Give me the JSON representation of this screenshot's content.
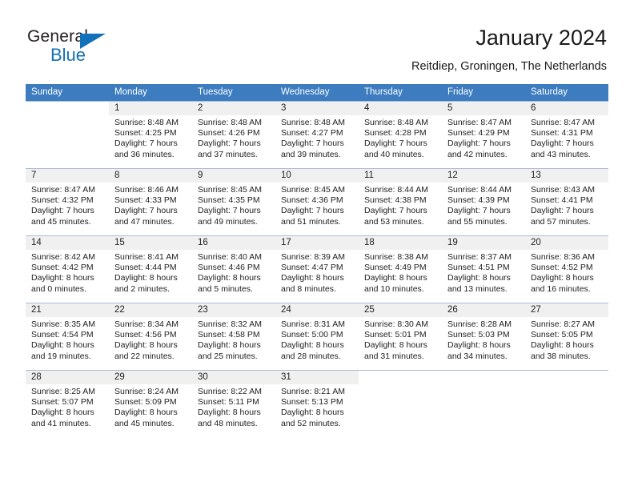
{
  "brand": {
    "name_part1": "General",
    "name_part2": "Blue",
    "logo_icon": "triangle-icon"
  },
  "header": {
    "title": "January 2024",
    "subtitle": "Reitdiep, Groningen, The Netherlands"
  },
  "colors": {
    "header_row_bg": "#3c7cbf",
    "daynum_band_bg": "#f0f0f0",
    "grid_line": "#a9bdd4",
    "brand_blue": "#1271b8",
    "text": "#222222"
  },
  "weekday_headers": [
    "Sunday",
    "Monday",
    "Tuesday",
    "Wednesday",
    "Thursday",
    "Friday",
    "Saturday"
  ],
  "weeks": [
    [
      {
        "day": "",
        "lines": []
      },
      {
        "day": "1",
        "lines": [
          "Sunrise: 8:48 AM",
          "Sunset: 4:25 PM",
          "Daylight: 7 hours",
          "and 36 minutes."
        ]
      },
      {
        "day": "2",
        "lines": [
          "Sunrise: 8:48 AM",
          "Sunset: 4:26 PM",
          "Daylight: 7 hours",
          "and 37 minutes."
        ]
      },
      {
        "day": "3",
        "lines": [
          "Sunrise: 8:48 AM",
          "Sunset: 4:27 PM",
          "Daylight: 7 hours",
          "and 39 minutes."
        ]
      },
      {
        "day": "4",
        "lines": [
          "Sunrise: 8:48 AM",
          "Sunset: 4:28 PM",
          "Daylight: 7 hours",
          "and 40 minutes."
        ]
      },
      {
        "day": "5",
        "lines": [
          "Sunrise: 8:47 AM",
          "Sunset: 4:29 PM",
          "Daylight: 7 hours",
          "and 42 minutes."
        ]
      },
      {
        "day": "6",
        "lines": [
          "Sunrise: 8:47 AM",
          "Sunset: 4:31 PM",
          "Daylight: 7 hours",
          "and 43 minutes."
        ]
      }
    ],
    [
      {
        "day": "7",
        "lines": [
          "Sunrise: 8:47 AM",
          "Sunset: 4:32 PM",
          "Daylight: 7 hours",
          "and 45 minutes."
        ]
      },
      {
        "day": "8",
        "lines": [
          "Sunrise: 8:46 AM",
          "Sunset: 4:33 PM",
          "Daylight: 7 hours",
          "and 47 minutes."
        ]
      },
      {
        "day": "9",
        "lines": [
          "Sunrise: 8:45 AM",
          "Sunset: 4:35 PM",
          "Daylight: 7 hours",
          "and 49 minutes."
        ]
      },
      {
        "day": "10",
        "lines": [
          "Sunrise: 8:45 AM",
          "Sunset: 4:36 PM",
          "Daylight: 7 hours",
          "and 51 minutes."
        ]
      },
      {
        "day": "11",
        "lines": [
          "Sunrise: 8:44 AM",
          "Sunset: 4:38 PM",
          "Daylight: 7 hours",
          "and 53 minutes."
        ]
      },
      {
        "day": "12",
        "lines": [
          "Sunrise: 8:44 AM",
          "Sunset: 4:39 PM",
          "Daylight: 7 hours",
          "and 55 minutes."
        ]
      },
      {
        "day": "13",
        "lines": [
          "Sunrise: 8:43 AM",
          "Sunset: 4:41 PM",
          "Daylight: 7 hours",
          "and 57 minutes."
        ]
      }
    ],
    [
      {
        "day": "14",
        "lines": [
          "Sunrise: 8:42 AM",
          "Sunset: 4:42 PM",
          "Daylight: 8 hours",
          "and 0 minutes."
        ]
      },
      {
        "day": "15",
        "lines": [
          "Sunrise: 8:41 AM",
          "Sunset: 4:44 PM",
          "Daylight: 8 hours",
          "and 2 minutes."
        ]
      },
      {
        "day": "16",
        "lines": [
          "Sunrise: 8:40 AM",
          "Sunset: 4:46 PM",
          "Daylight: 8 hours",
          "and 5 minutes."
        ]
      },
      {
        "day": "17",
        "lines": [
          "Sunrise: 8:39 AM",
          "Sunset: 4:47 PM",
          "Daylight: 8 hours",
          "and 8 minutes."
        ]
      },
      {
        "day": "18",
        "lines": [
          "Sunrise: 8:38 AM",
          "Sunset: 4:49 PM",
          "Daylight: 8 hours",
          "and 10 minutes."
        ]
      },
      {
        "day": "19",
        "lines": [
          "Sunrise: 8:37 AM",
          "Sunset: 4:51 PM",
          "Daylight: 8 hours",
          "and 13 minutes."
        ]
      },
      {
        "day": "20",
        "lines": [
          "Sunrise: 8:36 AM",
          "Sunset: 4:52 PM",
          "Daylight: 8 hours",
          "and 16 minutes."
        ]
      }
    ],
    [
      {
        "day": "21",
        "lines": [
          "Sunrise: 8:35 AM",
          "Sunset: 4:54 PM",
          "Daylight: 8 hours",
          "and 19 minutes."
        ]
      },
      {
        "day": "22",
        "lines": [
          "Sunrise: 8:34 AM",
          "Sunset: 4:56 PM",
          "Daylight: 8 hours",
          "and 22 minutes."
        ]
      },
      {
        "day": "23",
        "lines": [
          "Sunrise: 8:32 AM",
          "Sunset: 4:58 PM",
          "Daylight: 8 hours",
          "and 25 minutes."
        ]
      },
      {
        "day": "24",
        "lines": [
          "Sunrise: 8:31 AM",
          "Sunset: 5:00 PM",
          "Daylight: 8 hours",
          "and 28 minutes."
        ]
      },
      {
        "day": "25",
        "lines": [
          "Sunrise: 8:30 AM",
          "Sunset: 5:01 PM",
          "Daylight: 8 hours",
          "and 31 minutes."
        ]
      },
      {
        "day": "26",
        "lines": [
          "Sunrise: 8:28 AM",
          "Sunset: 5:03 PM",
          "Daylight: 8 hours",
          "and 34 minutes."
        ]
      },
      {
        "day": "27",
        "lines": [
          "Sunrise: 8:27 AM",
          "Sunset: 5:05 PM",
          "Daylight: 8 hours",
          "and 38 minutes."
        ]
      }
    ],
    [
      {
        "day": "28",
        "lines": [
          "Sunrise: 8:25 AM",
          "Sunset: 5:07 PM",
          "Daylight: 8 hours",
          "and 41 minutes."
        ]
      },
      {
        "day": "29",
        "lines": [
          "Sunrise: 8:24 AM",
          "Sunset: 5:09 PM",
          "Daylight: 8 hours",
          "and 45 minutes."
        ]
      },
      {
        "day": "30",
        "lines": [
          "Sunrise: 8:22 AM",
          "Sunset: 5:11 PM",
          "Daylight: 8 hours",
          "and 48 minutes."
        ]
      },
      {
        "day": "31",
        "lines": [
          "Sunrise: 8:21 AM",
          "Sunset: 5:13 PM",
          "Daylight: 8 hours",
          "and 52 minutes."
        ]
      },
      {
        "day": "",
        "lines": []
      },
      {
        "day": "",
        "lines": []
      },
      {
        "day": "",
        "lines": []
      }
    ]
  ]
}
